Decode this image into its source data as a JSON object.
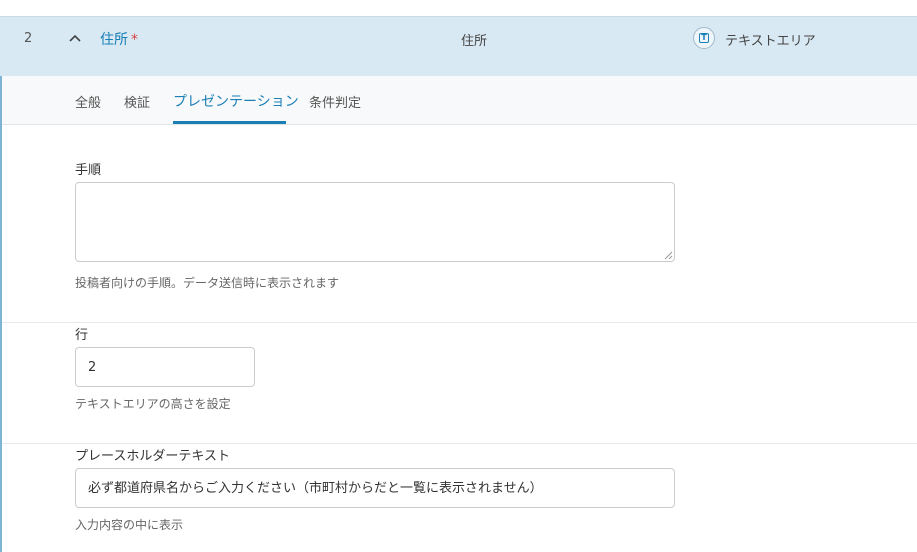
{
  "field": {
    "index": "2",
    "name": "住所",
    "required_mark": "*",
    "label": "住所",
    "type_icon": "textarea-icon",
    "type_label": "テキストエリア"
  },
  "tabs": [
    {
      "label": "全般",
      "active": false
    },
    {
      "label": "検証",
      "active": false
    },
    {
      "label": "プレゼンテーション",
      "active": true
    },
    {
      "label": "条件判定",
      "active": false
    }
  ],
  "instructions": {
    "label": "手順",
    "value": "",
    "help": "投稿者向けの手順。データ送信時に表示されます"
  },
  "rows": {
    "label": "行",
    "value": "2",
    "help": "テキストエリアの高さを設定"
  },
  "placeholder": {
    "label": "プレースホルダーテキスト",
    "value": "必ず都道府県名からご入力ください（市町村からだと一覧に表示されません）",
    "help": "入力内容の中に表示"
  },
  "colors": {
    "accent": "#1a7fb5",
    "row_background": "#d8e9f3",
    "required": "#d64545"
  }
}
